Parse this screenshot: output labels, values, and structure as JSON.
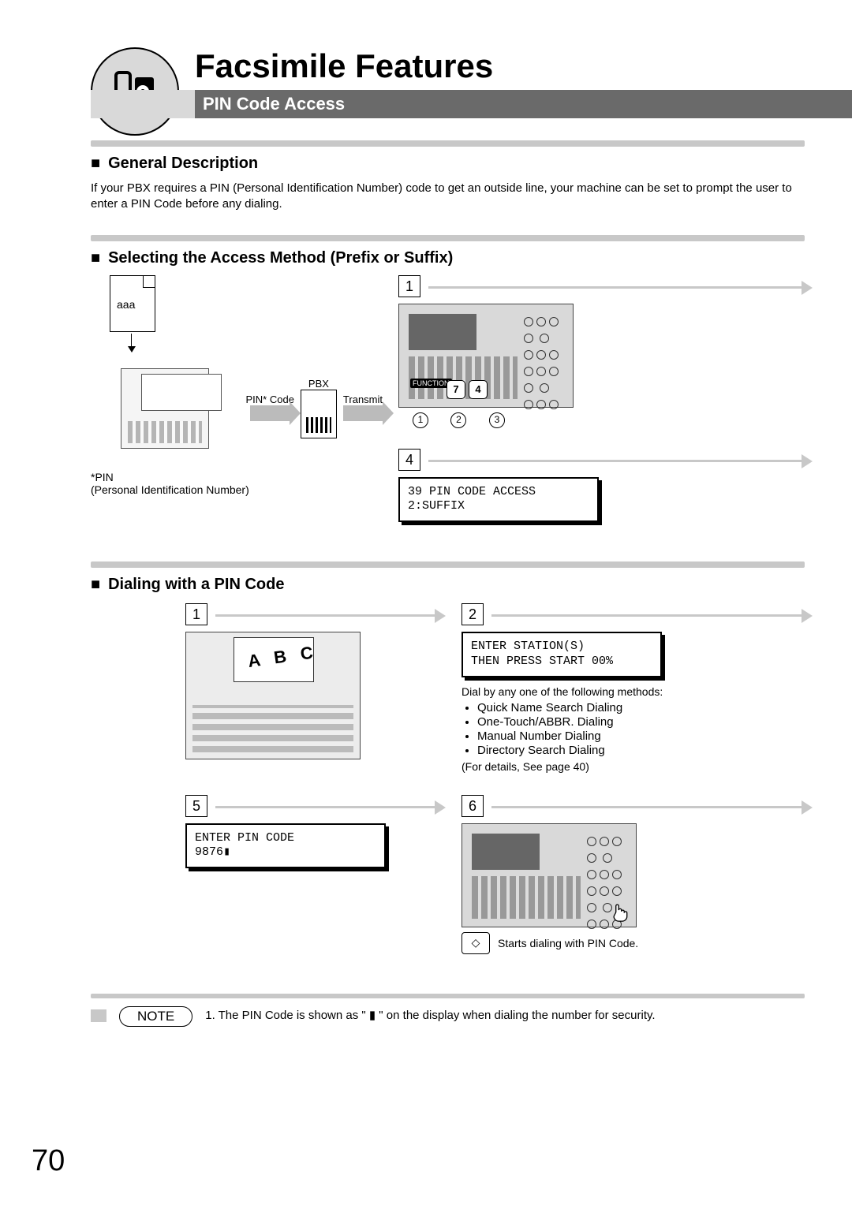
{
  "header": {
    "main_title": "Facsimile Features",
    "subtitle": "PIN Code Access"
  },
  "general": {
    "heading": "General Description",
    "text": "If your PBX requires a PIN (Personal Identification Number) code to get an outside line, your machine can be set to prompt the user to enter a PIN Code before any dialing."
  },
  "selecting": {
    "heading": "Selecting the Access Method (Prefix or Suffix)",
    "doc_label": "aaa",
    "pbx_label": "PBX",
    "pin_code_label": "PIN* Code",
    "transmit_label": "Transmit",
    "pin_footnote_1": "*PIN",
    "pin_footnote_2": "(Personal Identification Number)",
    "step1": "1",
    "step4": "4",
    "function_label": "FUNCTION",
    "key7": "7",
    "key4": "4",
    "ref1": "1",
    "ref2": "2",
    "ref3": "3",
    "lcd4_line1": "39 PIN CODE ACCESS",
    "lcd4_line2": "2:SUFFIX"
  },
  "dialing": {
    "heading": "Dialing with a PIN Code",
    "step1": "1",
    "step2": "2",
    "step5": "5",
    "step6": "6",
    "abc": "A B C",
    "lcd2_line1": "ENTER STATION(S)",
    "lcd2_line2": "THEN PRESS START 00%",
    "methods_intro": "Dial by any one of the following methods:",
    "methods": [
      "Quick Name Search Dialing",
      "One-Touch/ABBR. Dialing",
      "Manual Number Dialing",
      "Directory Search Dialing"
    ],
    "methods_ref": "(For details, See page 40)",
    "lcd5_line1": "ENTER PIN CODE",
    "lcd5_line2": "9876▮",
    "start_caption": "Starts dialing with PIN Code.",
    "start_btn": "START",
    "start_diamond": "◇"
  },
  "note": {
    "label": "NOTE",
    "text": "1.  The PIN Code is shown as \" ▮ \" on the display when dialing the number for security."
  },
  "page_number": "70"
}
